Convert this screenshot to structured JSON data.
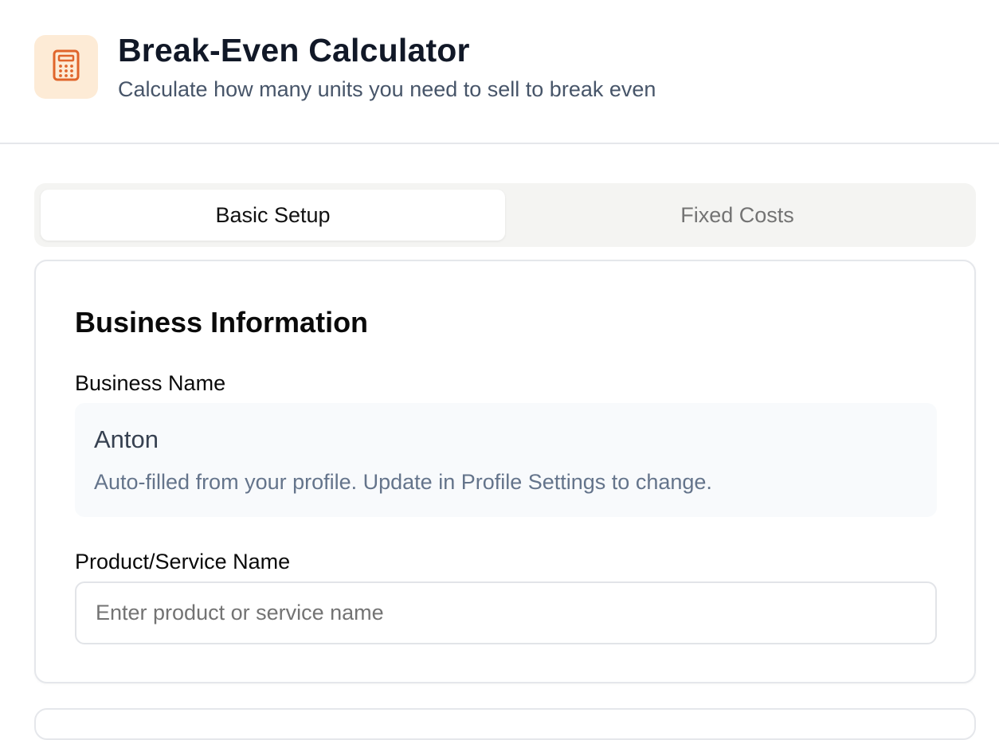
{
  "header": {
    "icon": "calculator-icon",
    "title": "Break-Even Calculator",
    "subtitle": "Calculate how many units you need to sell to break even"
  },
  "tabs": [
    {
      "label": "Basic Setup",
      "active": true
    },
    {
      "label": "Fixed Costs",
      "active": false
    }
  ],
  "business_info": {
    "title": "Business Information",
    "business_name_label": "Business Name",
    "business_name_value": "Anton",
    "business_name_help": "Auto-filled from your profile. Update in Profile Settings to change.",
    "product_label": "Product/Service Name",
    "product_value": "",
    "product_placeholder": "Enter product or service name"
  },
  "colors": {
    "accent": "#e0652b",
    "logo_bg": "#fdebd6"
  }
}
